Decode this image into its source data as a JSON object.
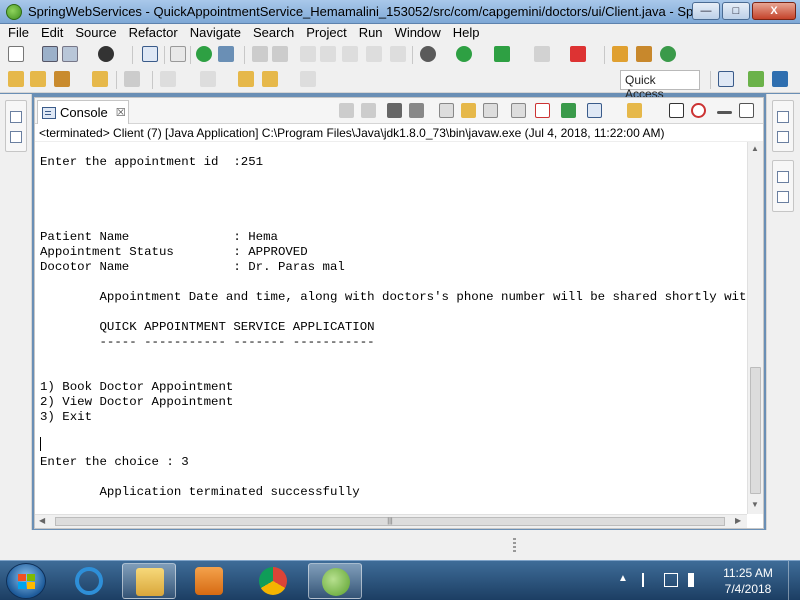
{
  "window": {
    "title": "SpringWebServices - QuickAppointmentService_Hemamalini_153052/src/com/capgemini/doctors/ui/Client.java - Spring Too...",
    "minimize_label": "—",
    "maximize_label": "□",
    "close_label": "X"
  },
  "menu": [
    "File",
    "Edit",
    "Source",
    "Refactor",
    "Navigate",
    "Search",
    "Project",
    "Run",
    "Window",
    "Help"
  ],
  "quick_access": {
    "label": "Quick Access"
  },
  "console": {
    "tab_label": "Console",
    "tab_close": "☒",
    "status": "<terminated> Client (7) [Java Application] C:\\Program Files\\Java\\jdk1.8.0_73\\bin\\javaw.exe (Jul 4, 2018, 11:22:00 AM)",
    "lines": [
      "Enter the appointment id  :251",
      "Patient Name              : Hema",
      "Appointment Status        : APPROVED",
      "Docotor Name              : Dr. Paras mal",
      "        Appointment Date and time, along with doctors's phone number will be shared shortly with you.",
      "        QUICK APPOINTMENT SERVICE APPLICATION",
      "        ----- ----------- ------- -----------",
      "1) Book Doctor Appointment",
      "2) View Doctor Appointment",
      "3) Exit",
      "Enter the choice : 3",
      "        Application terminated successfully"
    ],
    "hscroll_grip": "|||"
  },
  "taskbar": {
    "clock_time": "11:25 AM",
    "clock_date": "7/4/2018",
    "apps": [
      "internet-explorer",
      "file-explorer",
      "media-player",
      "chrome",
      "spring-tool-suite"
    ]
  },
  "colors": {
    "titlebar": "#7ea8d6",
    "taskbar": "#1c3e63",
    "chrome_bg": "#f0f0f0"
  }
}
